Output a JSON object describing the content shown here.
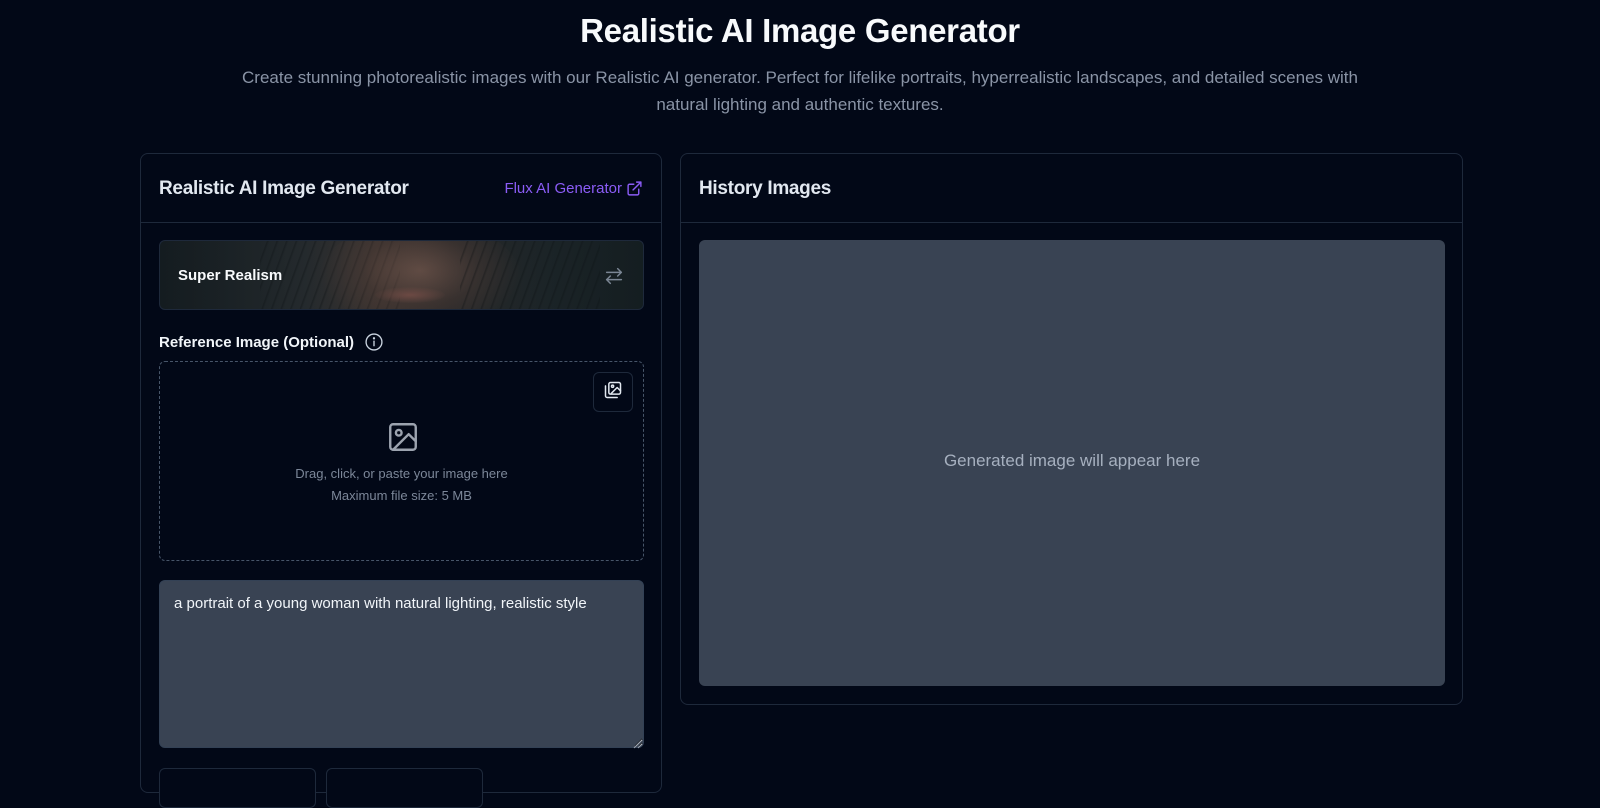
{
  "page": {
    "title": "Realistic AI Image Generator",
    "subtitle": "Create stunning photorealistic images with our Realistic AI generator. Perfect for lifelike portraits, hyperrealistic landscapes, and detailed scenes with natural lighting and authentic textures."
  },
  "generator": {
    "title": "Realistic AI Image Generator",
    "flux_link": "Flux AI Generator",
    "style": {
      "label": "Super Realism",
      "icon": "swap-icon"
    },
    "reference": {
      "label": "Reference Image (Optional)",
      "info_icon": "info-icon",
      "drop_text": "Drag, click, or paste your image here",
      "max_size": "Maximum file size: 5 MB",
      "gallery_icon": "image-gallery-icon",
      "image_icon": "image-icon"
    },
    "prompt": {
      "value": "a portrait of a young woman with natural lighting, realistic style"
    }
  },
  "history": {
    "title": "History Images",
    "placeholder": "Generated image will appear here"
  },
  "colors": {
    "background": "#020817",
    "border": "#1e293b",
    "accent": "#8b5cf6",
    "panel": "#394353"
  }
}
